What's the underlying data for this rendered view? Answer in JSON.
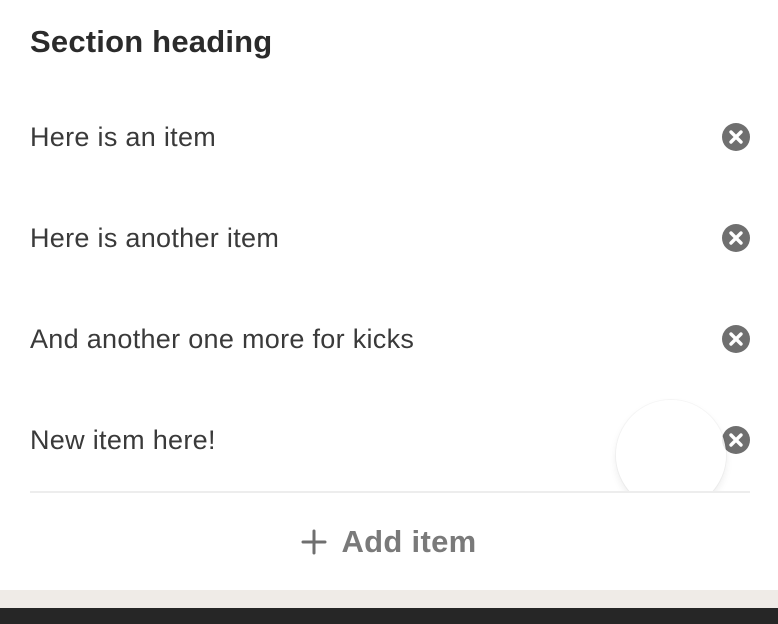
{
  "section": {
    "heading": "Section heading"
  },
  "items": [
    {
      "label": "Here is an item",
      "remove_icon": "close-circle-icon"
    },
    {
      "label": "Here is another item",
      "remove_icon": "close-circle-icon"
    },
    {
      "label": "And another one more for kicks",
      "remove_icon": "close-circle-icon"
    },
    {
      "label": "New item here!",
      "remove_icon": "close-circle-icon"
    }
  ],
  "add_item": {
    "icon": "plus-icon",
    "label": "Add item"
  },
  "colors": {
    "icon": "#6f6f6f",
    "divider": "#ededed",
    "bottom_band": "#efebe7",
    "bottom_bar": "#262626"
  }
}
